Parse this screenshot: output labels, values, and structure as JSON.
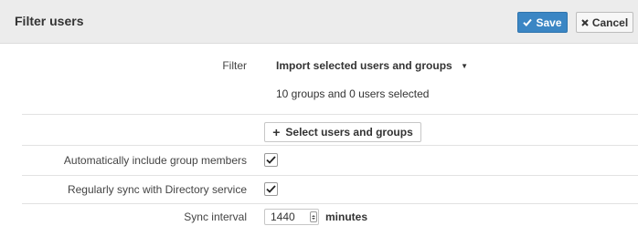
{
  "header": {
    "title": "Filter users",
    "save_label": "Save",
    "cancel_label": "Cancel"
  },
  "filter": {
    "label": "Filter",
    "selected_option": "Import selected users and groups",
    "summary": "10 groups and 0 users selected",
    "select_button_label": "Select users and groups"
  },
  "options": {
    "auto_include_label": "Automatically include group members",
    "auto_include_checked": true,
    "regular_sync_label": "Regularly sync with Directory service",
    "regular_sync_checked": true
  },
  "sync": {
    "label": "Sync interval",
    "value": "1440",
    "units": "minutes"
  },
  "colors": {
    "header_bg": "#ececec",
    "save_bg": "#3b86c4",
    "cancel_bg": "#f7f7f7"
  },
  "icons": {
    "save": "check-icon",
    "cancel": "x-icon",
    "add": "plus-icon",
    "dropdown": "caret-down-icon",
    "stepper": "stepper-icon"
  }
}
